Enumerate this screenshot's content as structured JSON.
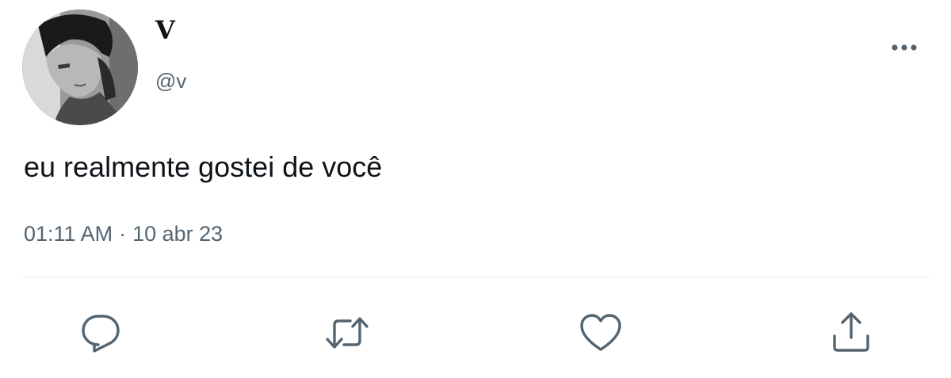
{
  "tweet": {
    "display_name": "V",
    "handle": "@v",
    "text": "eu realmente gostei de você",
    "time": "01:11 AM",
    "separator": "·",
    "date": "10 abr 23"
  },
  "icons": {
    "avatar": "profile-photo",
    "more": "more-horizontal-icon",
    "reply": "reply-icon",
    "retweet": "retweet-icon",
    "like": "heart-icon",
    "share": "share-icon"
  },
  "colors": {
    "text": "#0f1419",
    "secondary": "#536471",
    "divider": "#eff3f4",
    "icon": "#536471"
  }
}
